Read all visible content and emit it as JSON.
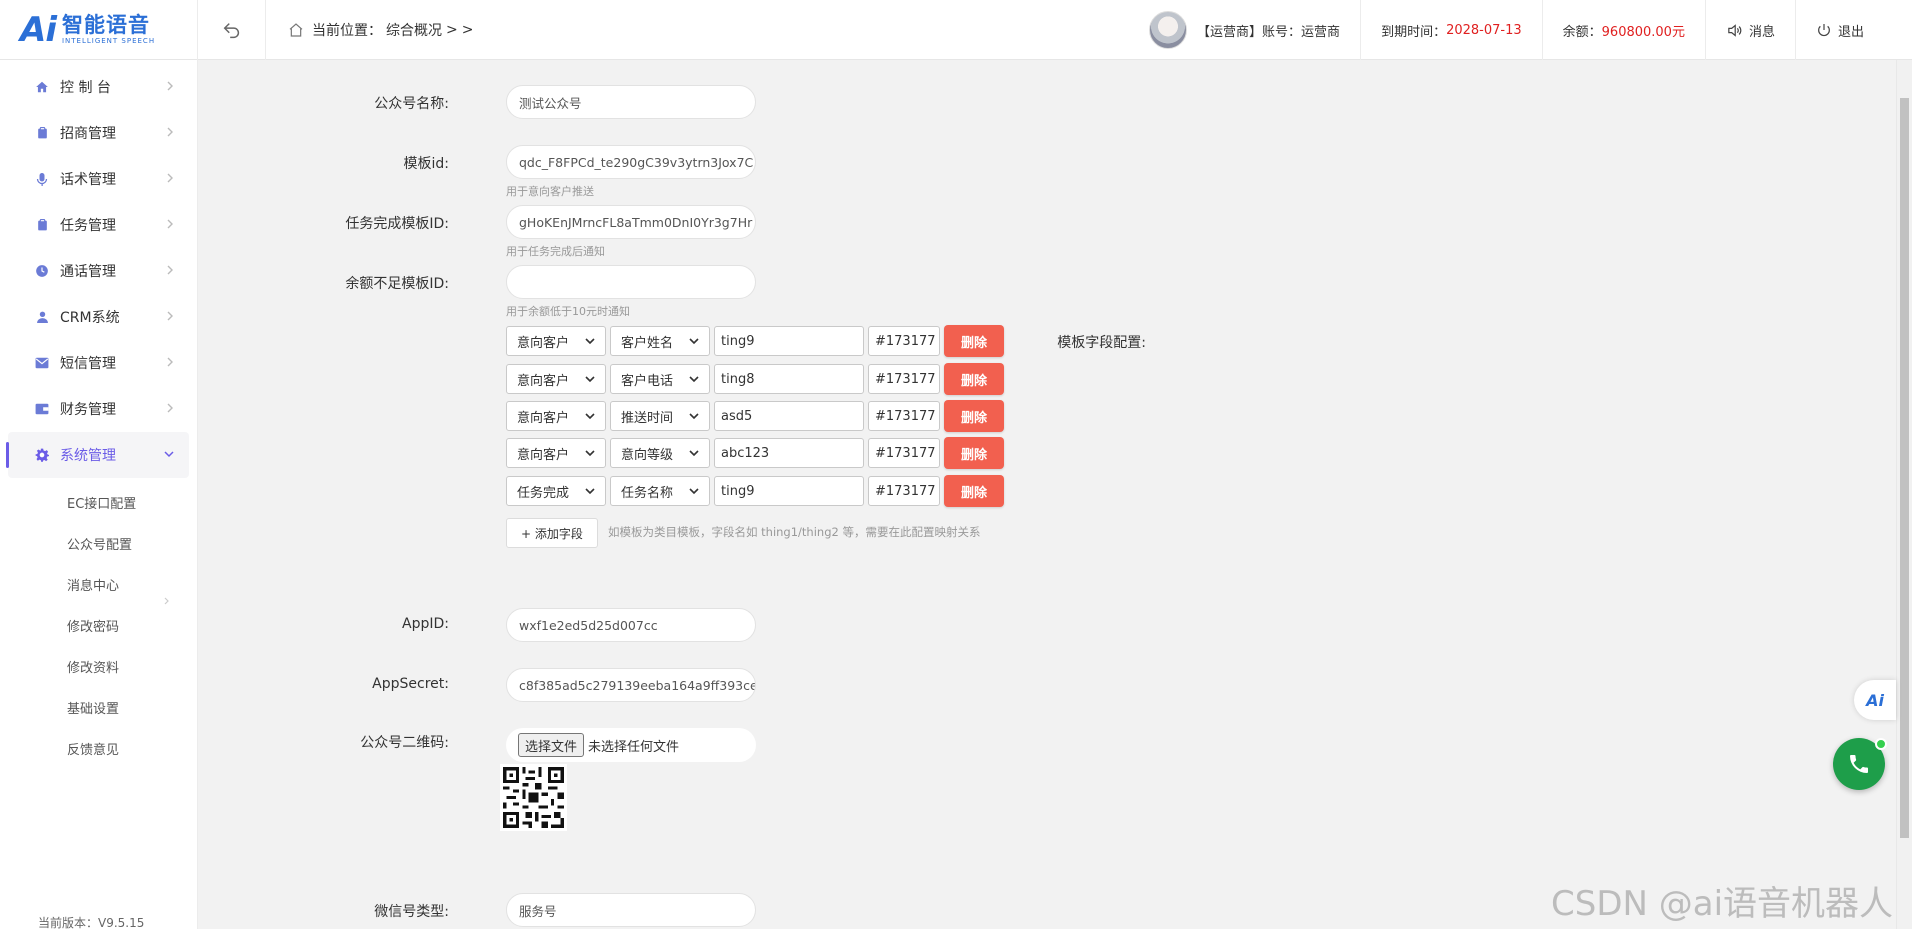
{
  "logo": {
    "mark": "Ai",
    "cn": "智能语音",
    "en": "INTELLIGENT SPEECH"
  },
  "breadcrumb": {
    "prefix": "当前位置：",
    "current": "综合概况",
    "sep1": ">",
    "sep2": ">"
  },
  "header": {
    "account": "【运营商】账号：运营商",
    "expire_label": "到期时间：",
    "expire_value": "2028-07-13",
    "balance_label": "余额：",
    "balance_value": "960800.00元",
    "messages": "消息",
    "logout": "退出"
  },
  "sidebar": {
    "items": [
      {
        "label": "控 制 台",
        "icon": "home-icon"
      },
      {
        "label": "招商管理",
        "icon": "clipboard-icon"
      },
      {
        "label": "话术管理",
        "icon": "mic-icon"
      },
      {
        "label": "任务管理",
        "icon": "clipboard-icon"
      },
      {
        "label": "通话管理",
        "icon": "clock-icon"
      },
      {
        "label": "CRM系统",
        "icon": "user-icon"
      },
      {
        "label": "短信管理",
        "icon": "mail-icon"
      },
      {
        "label": "财务管理",
        "icon": "wallet-icon"
      },
      {
        "label": "系统管理",
        "icon": "gear-icon"
      }
    ],
    "sub_items": [
      "EC接口配置",
      "公众号配置",
      "消息中心",
      "修改密码",
      "修改资料",
      "基础设置",
      "反馈意见"
    ],
    "version": "当前版本：V9.5.15"
  },
  "form": {
    "name_label": "公众号名称:",
    "name_value": "测试公众号",
    "template_id_label": "模板id:",
    "template_id_value": "qdc_F8FPCd_te290gC39v3ytrn3Jox7C",
    "template_id_hint": "用于意向客户推送",
    "task_template_label": "任务完成模板ID:",
    "task_template_value": "gHoKEnJMrncFL8aTmm0DnI0Yr3g7Hr",
    "task_template_hint": "用于任务完成后通知",
    "balance_template_label": "余额不足模板ID:",
    "balance_template_value": "",
    "balance_template_hint": "用于余额低于10元时通知",
    "fields_label": "模板字段配置:",
    "fields": [
      {
        "type": "意向客户",
        "field": "客户姓名",
        "key": "ting9",
        "color": "#173177",
        "delete": "删除"
      },
      {
        "type": "意向客户",
        "field": "客户电话",
        "key": "ting8",
        "color": "#173177",
        "delete": "删除"
      },
      {
        "type": "意向客户",
        "field": "推送时间",
        "key": "asd5",
        "color": "#173177",
        "delete": "删除"
      },
      {
        "type": "意向客户",
        "field": "意向等级",
        "key": "abc123",
        "color": "#173177",
        "delete": "删除"
      },
      {
        "type": "任务完成",
        "field": "任务名称",
        "key": "ting9",
        "color": "#173177",
        "delete": "删除"
      }
    ],
    "add_field": "+ 添加字段",
    "add_field_hint": "如模板为类目模板，字段名如 thing1/thing2 等，需要在此配置映射关系",
    "appid_label": "AppID:",
    "appid_value": "wxf1e2ed5d25d007cc",
    "appsecret_label": "AppSecret:",
    "appsecret_value": "c8f385ad5c279139eeba164a9ff393ce",
    "qrcode_label": "公众号二维码:",
    "file_button": "选择文件",
    "file_status": "未选择任何文件",
    "wechat_type_label": "微信号类型:",
    "wechat_type_value": "服务号"
  },
  "floating": {
    "ai_mark": "Ai"
  },
  "watermark": "CSDN @ai语音机器人",
  "colors": {
    "accent": "#6b5ce7",
    "danger": "#f2604f",
    "brand": "#2b6fd6",
    "call": "#1e9e4a"
  }
}
